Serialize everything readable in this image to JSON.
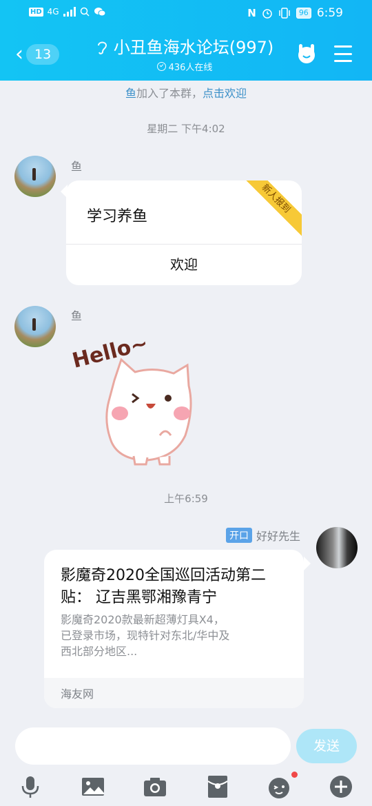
{
  "status_bar": {
    "hd": "HD",
    "network": "4G",
    "battery": "96",
    "time": "6:59"
  },
  "header": {
    "back_count": "13",
    "title": "小丑鱼海水论坛(997)",
    "online_text": "436人在线"
  },
  "notice": {
    "name": "鱼",
    "text": "加入了本群，",
    "action": "点击欢迎"
  },
  "messages": {
    "timestamp_1": "星期二 下午4:02",
    "msg1": {
      "sender": "鱼",
      "card_text": "学习养鱼",
      "ribbon": "新人报到",
      "button": "欢迎"
    },
    "msg2": {
      "sender": "鱼",
      "sticker_text": "Hello~"
    },
    "timestamp_2": "上午6:59",
    "msg3": {
      "tag": "开口",
      "sender": "好好先生",
      "title": "影魔奇2020全国巡回活动第二贴： 辽吉黑鄂湘豫青宁",
      "description": "影魔奇2020款最新超薄灯具X4，已登录市场，现特针对东北/华中及西北部分地区...",
      "source": "海友网"
    }
  },
  "input": {
    "placeholder": "",
    "send_label": "发送"
  },
  "icons": {
    "toolbar": [
      "microphone-icon",
      "image-icon",
      "camera-icon",
      "red-packet-icon",
      "emoji-icon",
      "plus-icon"
    ]
  },
  "colors": {
    "header": "#13c4f4",
    "ribbon": "#f7c937",
    "send_disabled": "#aee6f8"
  }
}
